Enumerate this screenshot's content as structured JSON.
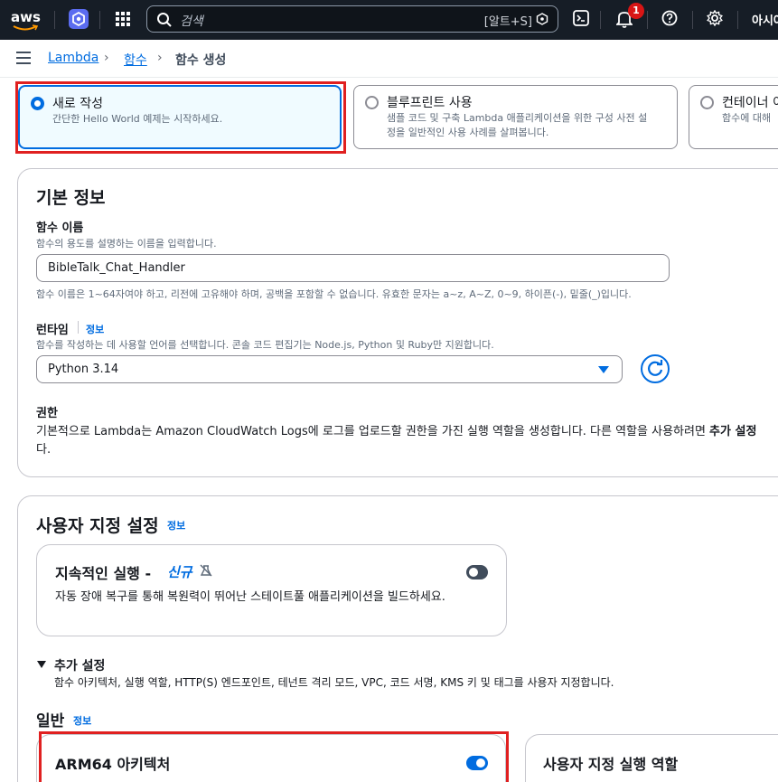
{
  "topnav": {
    "logo_text": "aws",
    "search_placeholder": "검색",
    "search_shortcut": "[알트+S]",
    "notification_count": "1",
    "region_label": "아시아"
  },
  "breadcrumb": {
    "items": [
      "Lambda",
      "함수",
      "함수 생성"
    ]
  },
  "create_options": [
    {
      "title": "새로 작성",
      "desc_lines": [
        "간단한 Hello World 예제는 시작하세요."
      ],
      "selected": true
    },
    {
      "title": "블루프린트 사용",
      "desc_lines": [
        "샘플 코드 및 구축 Lambda 애플리케이션을 위한 구성 사전 설",
        "정을 일반적인 사용 사례를 살펴봅니다."
      ],
      "selected": false
    },
    {
      "title": "컨테이너 이",
      "desc_lines": [
        "함수에 대해"
      ],
      "selected": false
    }
  ],
  "basic_info": {
    "heading": "기본 정보",
    "function_name_label": "함수 이름",
    "function_name_hint": "함수의 용도를 설명하는 이름을 입력합니다.",
    "function_name_value": "BibleTalk_Chat_Handler",
    "function_name_constraint": "함수 이름은 1~64자여야 하고, 리전에 고유해야 하며, 공백을 포함할 수 없습니다. 유효한 문자는 a~z, A~Z, 0~9, 하이픈(-), 밑줄(_)입니다.",
    "runtime_label": "런타임",
    "runtime_info": "정보",
    "runtime_hint": "함수를 작성하는 데 사용할 언어를 선택합니다. 콘솔 코드 편집기는 Node.js, Python 및 Ruby만 지원합니다.",
    "runtime_value": "Python 3.14",
    "permission_label": "권한",
    "permission_text_1": "기본적으로 Lambda는 Amazon CloudWatch Logs에 로그를 업로드할 권한을 가진 실행 역할을 생성합니다. 다른 역할을 사용하려면 ",
    "permission_text_bold": "추가 설정",
    "permission_text_2": "다."
  },
  "custom_settings": {
    "heading": "사용자 지정 설정",
    "info": "정보",
    "durable": {
      "title": "지속적인 실행 -",
      "new_badge": "신규",
      "desc": "자동 장애 복구를 통해 복원력이 뛰어난 스테이트풀 애플리케이션을 빌드하세요.",
      "enabled": false
    },
    "additional_toggle_label": "추가 설정",
    "additional_desc": "함수 아키텍처, 실행 역할, HTTP(S) 엔드포인트, 테넌트 격리 모드, VPC, 코드 서명, KMS 키 및 태그를 사용자 지정합니다.",
    "general_heading": "일반",
    "general_info": "정보",
    "arm64_label": "ARM64 아키텍처",
    "arm64_enabled": true,
    "exec_role_label": "사용자 지정 실행 역할"
  },
  "colors": {
    "accent": "#006ce0",
    "highlight_red": "#e02020",
    "nav_bg": "#161d26",
    "notification_red": "#d91515"
  }
}
